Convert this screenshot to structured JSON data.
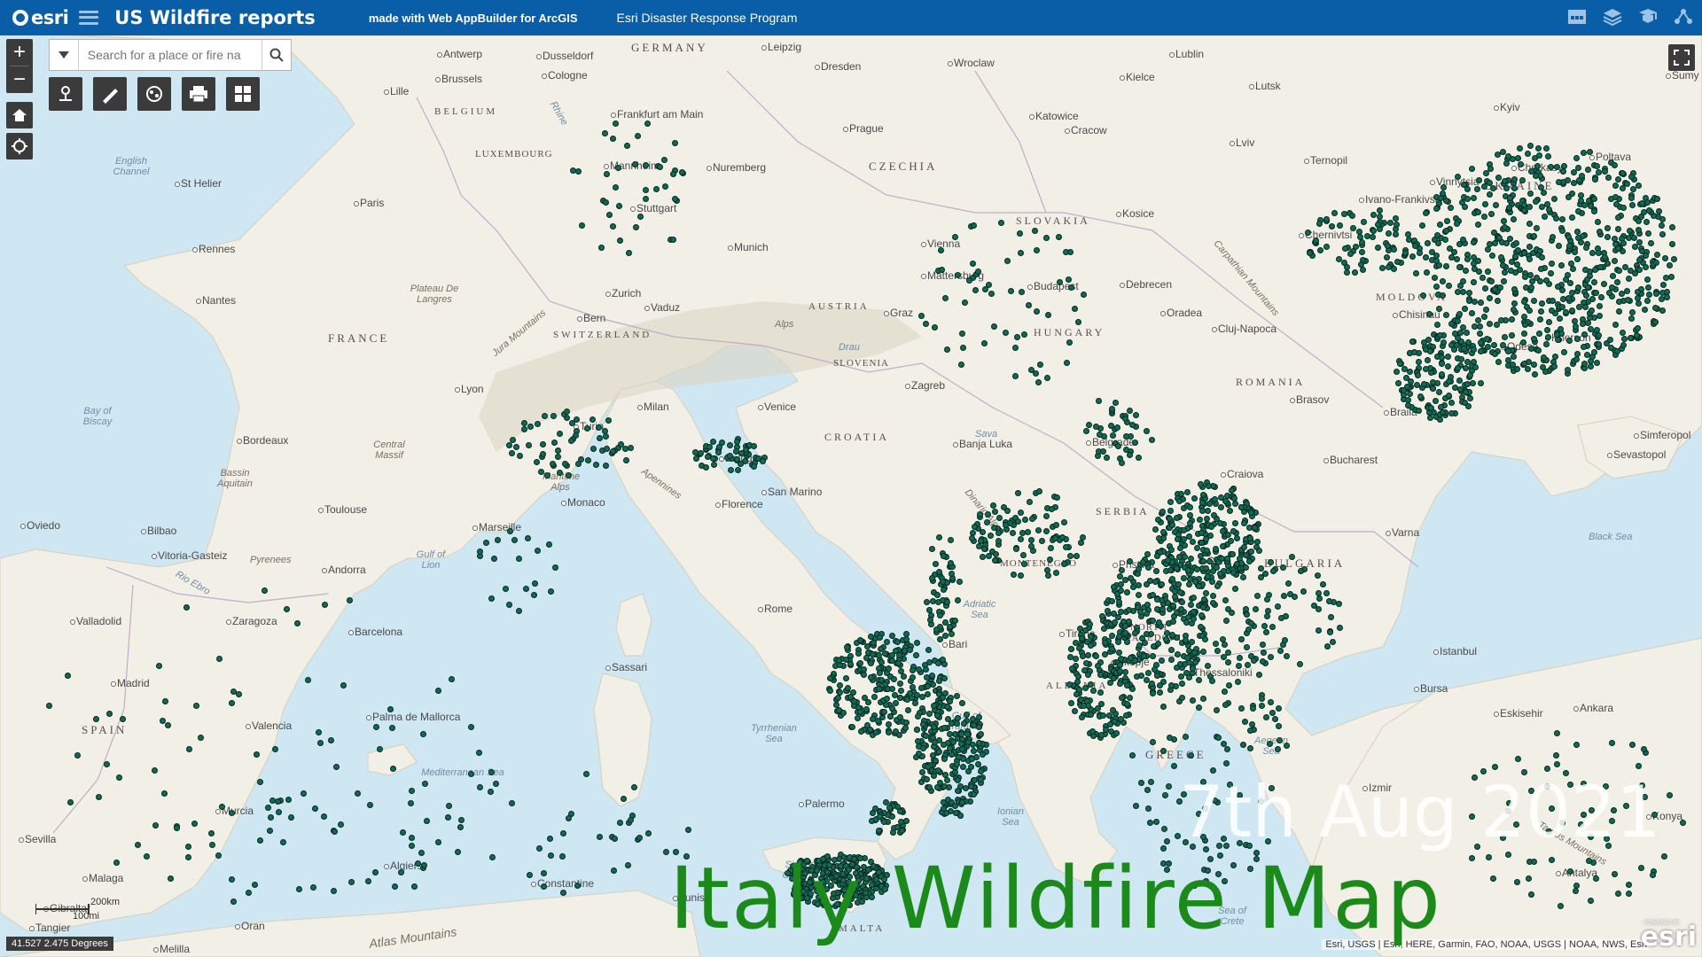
{
  "header": {
    "logo_text": "esri",
    "title": "US Wildfire reports",
    "made_with": "made with Web AppBuilder for ArcGIS",
    "program": "Esri Disaster Response Program",
    "right_icons": [
      "basemap-gallery-icon",
      "layer-list-icon",
      "legend-icon",
      "about-icon"
    ]
  },
  "search": {
    "placeholder": "Search for a place or fire na",
    "value": ""
  },
  "tools": [
    "directions-icon",
    "measure-icon",
    "filter-icon",
    "print-icon",
    "grid-icon"
  ],
  "map": {
    "labels_country": [
      {
        "text": "GERMANY"
      },
      {
        "text": "BELGIUM"
      },
      {
        "text": "LUXEMBOURG"
      },
      {
        "text": "FRANCE"
      },
      {
        "text": "SWITZERLAND"
      },
      {
        "text": "AUSTRIA"
      },
      {
        "text": "CZECHIA"
      },
      {
        "text": "SLOVAKIA"
      },
      {
        "text": "HUNGARY"
      },
      {
        "text": "SLOVENIA"
      },
      {
        "text": "CROATIA"
      },
      {
        "text": "SERBIA"
      },
      {
        "text": "ROMANIA"
      },
      {
        "text": "MOLDOVA"
      },
      {
        "text": "UKRAINE"
      },
      {
        "text": "BULGARIA"
      },
      {
        "text": "NORTH MACEDONIA"
      },
      {
        "text": "MONTENEGRO"
      },
      {
        "text": "ALBANIA"
      },
      {
        "text": "GREECE"
      },
      {
        "text": "SPAIN"
      },
      {
        "text": "MALTA"
      }
    ],
    "labels_city": [
      "Antwerp",
      "Dusseldorf",
      "Cologne",
      "Brussels",
      "Lille",
      "Leipzig",
      "Dresden",
      "Wroclaw",
      "Kielce",
      "Lublin",
      "Frankfurt am Main",
      "Katowice",
      "Cracow",
      "Prague",
      "Nuremberg",
      "Mannheim",
      "Stuttgart",
      "Munich",
      "Paris",
      "Rennes",
      "Nantes",
      "St Helier",
      "Lviv",
      "Ternopil",
      "Lutsk",
      "Kyiv",
      "Cherkasy",
      "Poltava",
      "Vinnytsia",
      "Ivano-Frankivsk",
      "Chernivtsi",
      "Kosice",
      "Vienna",
      "Mattersburg",
      "Budapest",
      "Debrecen",
      "Oradea",
      "Cluj-Napoca",
      "Chisinau",
      "Odesa",
      "Kherson",
      "Zurich",
      "Vaduz",
      "Bern",
      "Graz",
      "Lyon",
      "Milan",
      "Venice",
      "Turin",
      "Zagreb",
      "Banja Luka",
      "Belgrade",
      "Brasov",
      "Bucharest",
      "Craiova",
      "Braila",
      "Simferopol",
      "Sevastopol",
      "Bordeaux",
      "Bologna",
      "San Marino",
      "Florence",
      "Monaco",
      "Marseille",
      "Toulouse",
      "Andorra",
      "Bilbao",
      "Vitoria-Gasteiz",
      "Oviedo",
      "Valladolid",
      "Zaragoza",
      "Barcelona",
      "Madrid",
      "Valencia",
      "Murcia",
      "Sevilla",
      "Malaga",
      "Gibraltar",
      "Tangier",
      "Melilla",
      "Oran",
      "Algiers",
      "Constantine",
      "Tunis",
      "Palermo",
      "Palma de Mallorca",
      "Sassari",
      "Rome",
      "Bari",
      "Pristina",
      "Sofia",
      "Tirana",
      "Skopje",
      "Thessaloniki",
      "Varna",
      "Istanbul",
      "Bursa",
      "Izmir",
      "Eskisehir",
      "Ankara",
      "Antalya",
      "Konya",
      "Sumy"
    ],
    "labels_sea": [
      "English Channel",
      "Bay of Biscay",
      "Gulf of Lion",
      "Mediterranean Sea",
      "Tyrrhenian Sea",
      "Adriatic Sea",
      "Gulf of Taranto",
      "Ionian Sea",
      "Aegean Sea",
      "Black Sea",
      "Sicilian Channel",
      "Sea of Crete"
    ],
    "labels_region": [
      "Plateau De Langres",
      "Central Massif",
      "Bassin Aquitain",
      "Jura Mountains",
      "Alps",
      "Maritime Alps",
      "Apennines",
      "Pyrenees",
      "Carpathian Mountains",
      "Dinaric Alps",
      "Atlas Mountains",
      "Rio Ebro",
      "Drau",
      "Sava",
      "Rhine",
      "Taurus Mountains"
    ]
  },
  "scalebar": {
    "km": "200km",
    "mi": "100mi"
  },
  "coordinates": "41.527 2.475 Degrees",
  "attribution": "Esri, USGS | Esri, HERE, Garmin, FAO, NOAA, USGS | NOAA, NWS, Esri",
  "powered_by": "POWERED BY",
  "overlay": {
    "date": "7th Aug 2021",
    "title": "Italy Wildfire Map"
  },
  "colors": {
    "header": "#0a5ea7",
    "fire_points": "#0f6b55",
    "overlay_title": "#1b8a1b",
    "water": "#cfe6f3",
    "land": "#f1efe6"
  }
}
